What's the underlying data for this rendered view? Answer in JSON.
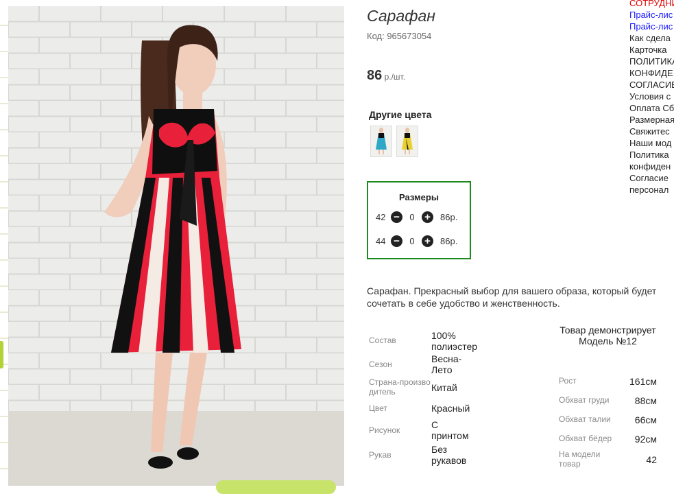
{
  "product": {
    "title": "Сарафан",
    "code": "Код: 965673054",
    "price": "86",
    "price_unit": " р./шт.",
    "other_colors_label": "Другие цвета"
  },
  "sizes": {
    "title": "Размеры",
    "rows": [
      {
        "size": "42",
        "qty": "0",
        "price": "86р."
      },
      {
        "size": "44",
        "qty": "0",
        "price": "86р."
      }
    ]
  },
  "description": "Сарафан. Прекрасный выбор для вашего образа, который будет сочетать в себе удобство и женственность.",
  "attributes": [
    {
      "key": "Состав",
      "value": "100% полиэстер"
    },
    {
      "key": "Сезон",
      "value": "Весна-Лето"
    },
    {
      "key": "Страна-производитель",
      "value": "Китай"
    },
    {
      "key": "Цвет",
      "value": "Красный"
    },
    {
      "key": "Рисунок",
      "value": "С принтом"
    },
    {
      "key": "Рукав",
      "value": "Без рукавов"
    }
  ],
  "model": {
    "heading": "Товар демонстрирует Модель №12",
    "measurements": [
      {
        "key": "Рост",
        "value": "161см"
      },
      {
        "key": "Обхват груди",
        "value": "88см"
      },
      {
        "key": "Обхват талии",
        "value": "66см"
      },
      {
        "key": "Обхват бёдер",
        "value": "92см"
      },
      {
        "key": "На модели товар",
        "value": "42"
      }
    ]
  },
  "right_nav": [
    {
      "label": "СОТРУДНИ",
      "color": "red"
    },
    {
      "label": "Прайс-лис",
      "color": "blue"
    },
    {
      "label": "Прайс-лис",
      "color": "blue"
    },
    {
      "label": "Как сдела",
      "color": "dark"
    },
    {
      "label": "Карточка",
      "color": "dark"
    },
    {
      "label": "ПОЛИТИКА",
      "color": "dark"
    },
    {
      "label": "КОНФИДЕ",
      "color": "dark"
    },
    {
      "label": "СОГЛАСИЕ",
      "color": "dark"
    },
    {
      "label": "Условия с",
      "color": "dark"
    },
    {
      "label": "Оплата Сб",
      "color": "dark"
    },
    {
      "label": "Размерная",
      "color": "dark"
    },
    {
      "label": "Свяжитес",
      "color": "dark"
    },
    {
      "label": "Наши мод",
      "color": "dark"
    },
    {
      "label": "Политика",
      "color": "dark"
    },
    {
      "label": "конфиден",
      "color": "dark"
    },
    {
      "label": "Согласие",
      "color": "dark"
    },
    {
      "label": "персонал",
      "color": "dark"
    }
  ],
  "colors": {
    "sizes_border": "#1e8a1e",
    "nav_red": "#e00000",
    "nav_blue": "#1a1aff"
  },
  "icons": {
    "minus": "minus-circle-icon",
    "plus": "plus-circle-icon"
  }
}
